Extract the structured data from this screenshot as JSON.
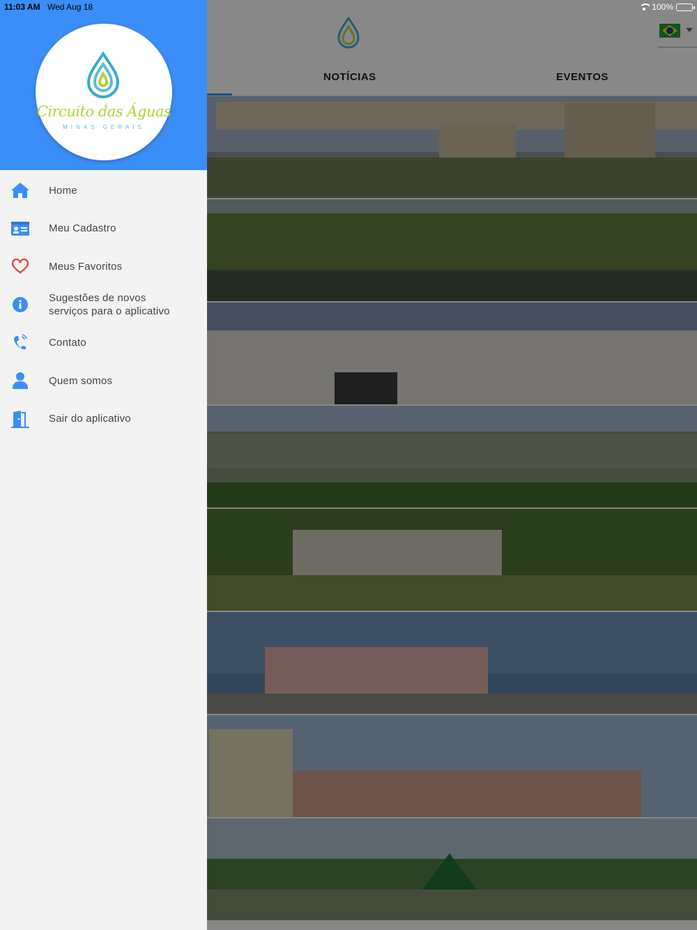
{
  "status_bar": {
    "time": "11:03 AM",
    "date": "Wed Aug 18",
    "battery": "100%",
    "battery_level": 1.0
  },
  "header": {
    "logo_icon": "water-drop-logo-icon",
    "language_flag": "brazil-flag-icon"
  },
  "tabs": [
    {
      "label": "NOTÍCIAS",
      "active": true
    },
    {
      "label": "EVENTOS",
      "active": false
    }
  ],
  "drawer": {
    "logo": {
      "title": "Circuito das Águas",
      "subtitle": "MINAS GERAIS"
    },
    "colors": {
      "header_bg": "#3b8ef7",
      "icon_blue": "#3b8ef7",
      "icon_red": "#e5464a"
    },
    "items": [
      {
        "label": "Home",
        "icon": "home-icon"
      },
      {
        "label": "Meu Cadastro",
        "icon": "id-card-icon"
      },
      {
        "label": "Meus Favoritos",
        "icon": "heart-icon"
      },
      {
        "label": "Sugestões de novos\nserviços para o aplicativo",
        "icon": "info-icon"
      },
      {
        "label": "Contato",
        "icon": "phone-icon"
      },
      {
        "label": "Quem somos",
        "icon": "user-icon"
      },
      {
        "label": "Sair do aplicativo",
        "icon": "exit-door-icon"
      }
    ]
  },
  "feed_images": [
    "baependi-gate-photo",
    "garden-lake-photo",
    "church-facade-photo",
    "valley-landscape-photo",
    "park-building-photo",
    "pink-church-photo",
    "tower-building-photo",
    "town-square-photo"
  ]
}
